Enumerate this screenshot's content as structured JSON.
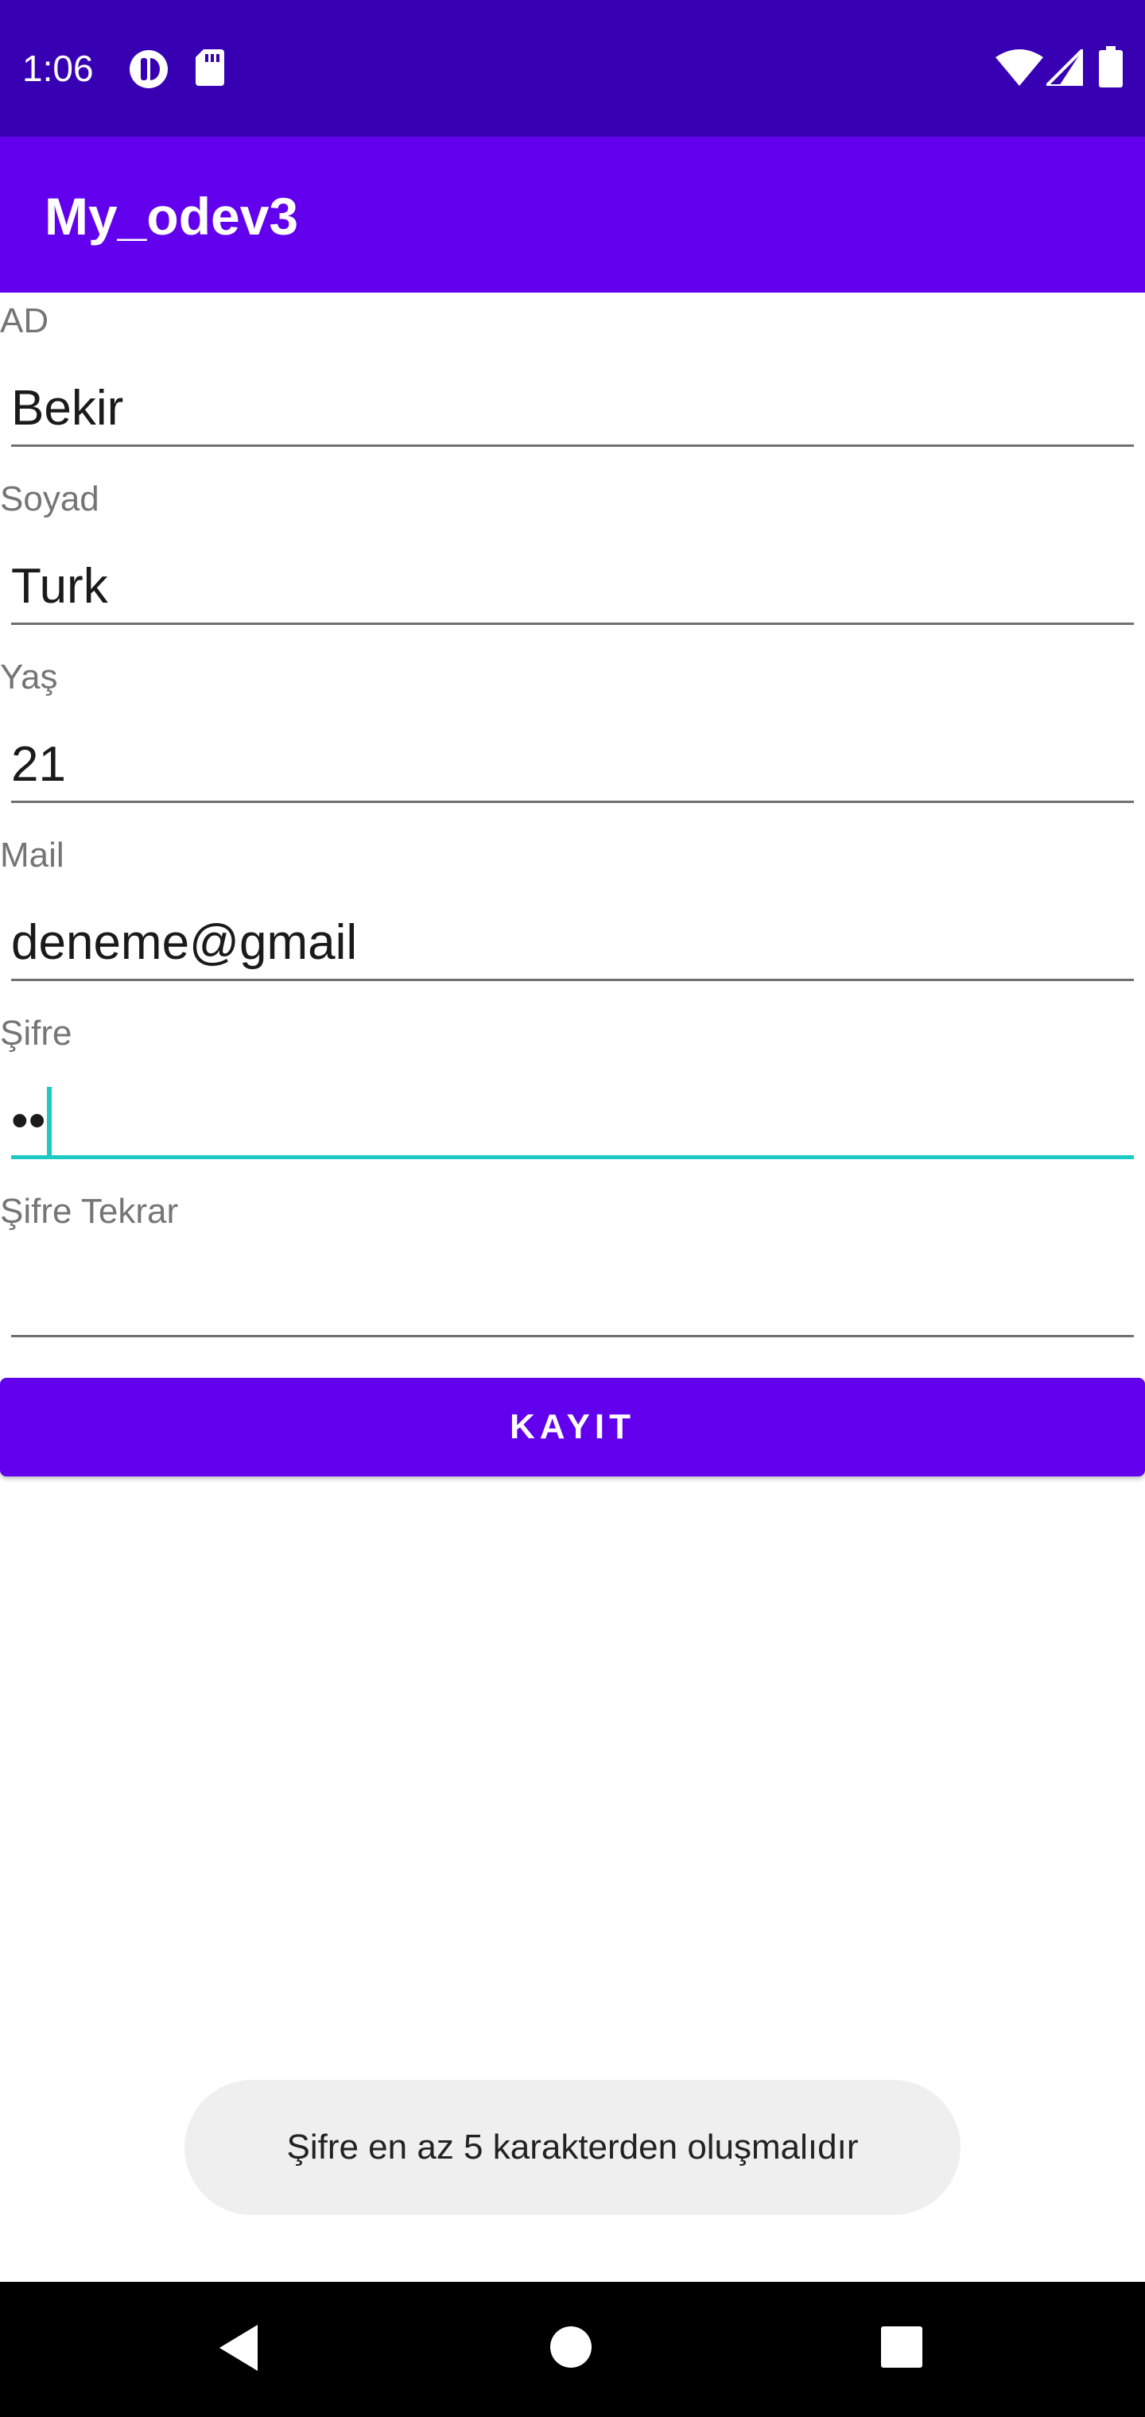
{
  "status_bar": {
    "time": "1:06",
    "icons": [
      "app-notification-icon",
      "sd-card-icon",
      "wifi-icon",
      "signal-icon",
      "battery-icon"
    ]
  },
  "app_bar": {
    "title": "My_odev3"
  },
  "form": {
    "fields": [
      {
        "label": "AD",
        "value": "Bekir"
      },
      {
        "label": "Soyad",
        "value": "Turk"
      },
      {
        "label": "Yaş",
        "value": "21"
      },
      {
        "label": "Mail",
        "value": "deneme@gmail"
      },
      {
        "label": "Şifre",
        "value": "••"
      },
      {
        "label": "Şifre Tekrar",
        "value": ""
      }
    ],
    "submit_label": "KAYIT"
  },
  "toast": {
    "message": "Şifre en az 5 karakterden oluşmalıdır"
  },
  "nav_bar": {
    "icons": [
      "back-icon",
      "home-icon",
      "recents-icon"
    ]
  },
  "colors": {
    "status_bar": "#3700B3",
    "primary": "#6200EE",
    "focus_accent": "#1ec9c4"
  }
}
